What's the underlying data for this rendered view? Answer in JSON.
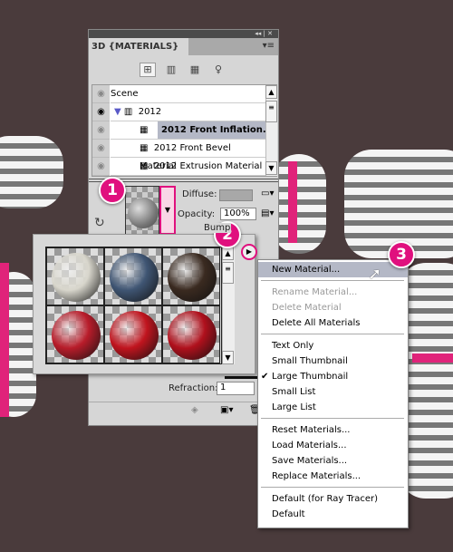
{
  "panel": {
    "title": "3D {MATERIALS}",
    "collapse_icon": "double-chevron-left-icon",
    "close_icon": "close-icon",
    "tools": [
      "scene-filter-icon",
      "mesh-filter-icon",
      "material-filter-icon",
      "light-filter-icon"
    ]
  },
  "tree": {
    "items": [
      {
        "label": "Scene",
        "type": "scene"
      },
      {
        "label": "2012",
        "type": "mesh"
      },
      {
        "label": "2012 Front Inflation...",
        "type": "material",
        "selected": true
      },
      {
        "label": "2012 Front Bevel Material",
        "type": "material"
      },
      {
        "label": "2012 Extrusion Material",
        "type": "material"
      }
    ]
  },
  "material": {
    "diffuse_label": "Diffuse:",
    "opacity_label": "Opacity:",
    "opacity_value": "100%",
    "bump_label": "Bump",
    "refraction_label": "Refraction:",
    "refraction_value": "1"
  },
  "picker": {
    "swatches": [
      {
        "name": "white-marble",
        "color": "#d8d6cc"
      },
      {
        "name": "blue-fabric",
        "color": "#3f5573"
      },
      {
        "name": "dark-wood",
        "color": "#3a2a20"
      },
      {
        "name": "red-pattern-1",
        "color": "#b81c2a"
      },
      {
        "name": "red-pattern-2",
        "color": "#c0141e"
      },
      {
        "name": "red-pattern-3",
        "color": "#b0101c"
      }
    ]
  },
  "menu": {
    "items": [
      {
        "label": "New Material...",
        "highlighted": true
      },
      {
        "sep": true
      },
      {
        "label": "Rename Material...",
        "disabled": true
      },
      {
        "label": "Delete Material",
        "disabled": true
      },
      {
        "label": "Delete All Materials"
      },
      {
        "sep": true
      },
      {
        "label": "Text Only"
      },
      {
        "label": "Small Thumbnail"
      },
      {
        "label": "Large Thumbnail",
        "checked": true
      },
      {
        "label": "Small List"
      },
      {
        "label": "Large List"
      },
      {
        "sep": true
      },
      {
        "label": "Reset Materials..."
      },
      {
        "label": "Load Materials..."
      },
      {
        "label": "Save Materials..."
      },
      {
        "label": "Replace Materials..."
      },
      {
        "sep": true
      },
      {
        "label": "Default (for Ray Tracer)"
      },
      {
        "label": "Default"
      }
    ]
  },
  "badges": [
    "1",
    "2",
    "3"
  ],
  "colors": {
    "accent": "#e0107e",
    "background": "#4a3b3c",
    "highlight": "#b4b8c6"
  }
}
